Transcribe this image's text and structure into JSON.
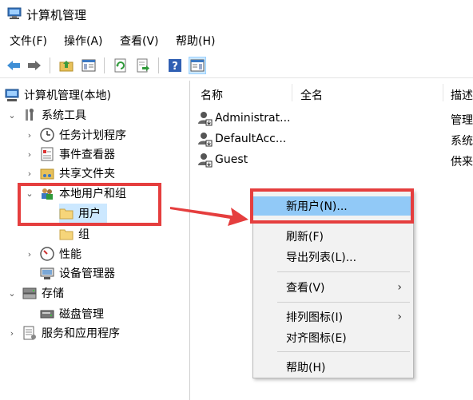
{
  "window": {
    "title": "计算机管理"
  },
  "menu": [
    "文件(F)",
    "操作(A)",
    "查看(V)",
    "帮助(H)"
  ],
  "toolbar": {
    "icons": [
      "back-arrow-icon",
      "forward-arrow-icon",
      "up-folder-icon",
      "console-tree-icon",
      "refresh-icon",
      "export-list-icon",
      "help-icon",
      "properties-icon"
    ]
  },
  "tree": {
    "root": "计算机管理(本地)",
    "system_tools": "系统工具",
    "task_scheduler": "任务计划程序",
    "event_viewer": "事件查看器",
    "shared_folders": "共享文件夹",
    "local_users_groups": "本地用户和组",
    "users": "用户",
    "groups": "组",
    "performance": "性能",
    "device_manager": "设备管理器",
    "storage": "存储",
    "disk_management": "磁盘管理",
    "services_apps": "服务和应用程序"
  },
  "list": {
    "columns": [
      "名称",
      "全名",
      "描述"
    ],
    "rows": [
      {
        "name": "Administrat...",
        "fullname": "",
        "desc": "管理"
      },
      {
        "name": "DefaultAcc...",
        "fullname": "",
        "desc": "系统"
      },
      {
        "name": "Guest",
        "fullname": "",
        "desc": "供来"
      }
    ]
  },
  "context_menu": {
    "new_user": "新用户(N)...",
    "refresh": "刷新(F)",
    "export_list": "导出列表(L)...",
    "view": "查看(V)",
    "arrange_icons": "排列图标(I)",
    "align_icons": "对齐图标(E)",
    "help": "帮助(H)"
  },
  "colors": {
    "highlight": "#91c9f7",
    "annotation_red": "#e53e3e",
    "selected_row": "#cce8ff"
  }
}
